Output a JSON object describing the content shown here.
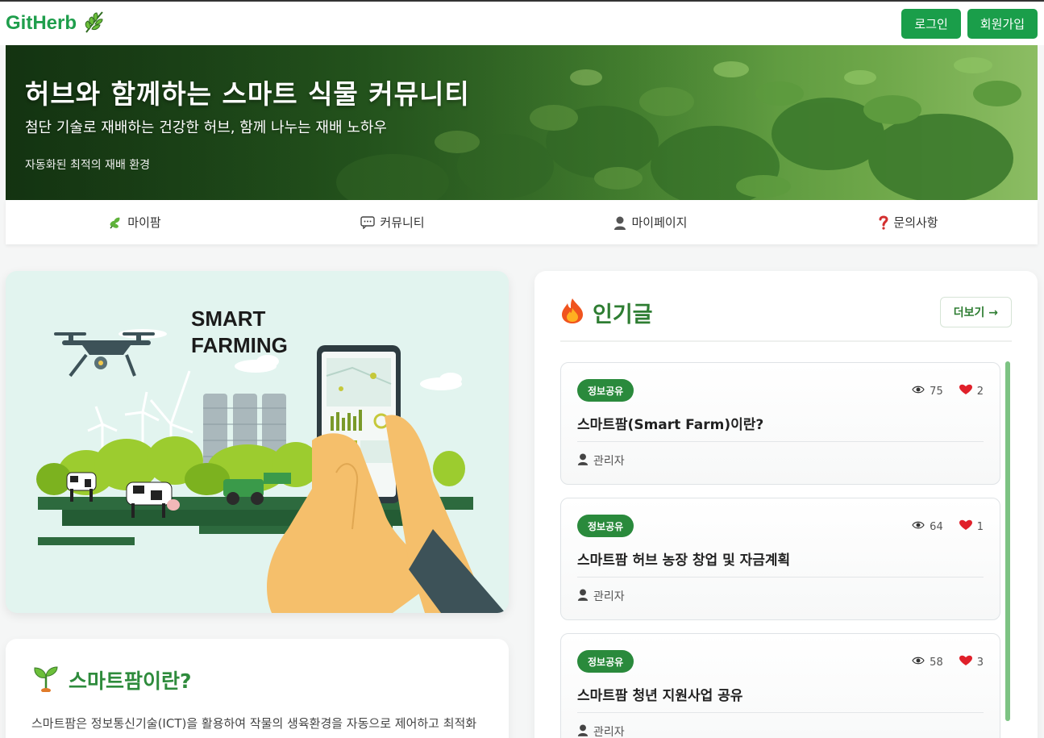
{
  "header": {
    "logo_text": "GitHerb",
    "login_label": "로그인",
    "signup_label": "회원가입"
  },
  "hero": {
    "title": "허브와 함께하는 스마트 식물 커뮤니티",
    "subtitle": "첨단 기술로 재배하는 건강한 허브, 함께 나누는 재배 노하우",
    "note": "자동화된 최적의 재배 환경"
  },
  "nav": {
    "items": [
      {
        "label": "마이팜",
        "icon": "herb-icon"
      },
      {
        "label": "커뮤니티",
        "icon": "chat-icon"
      },
      {
        "label": "마이페이지",
        "icon": "user-icon"
      },
      {
        "label": "문의사항",
        "icon": "question-icon"
      }
    ]
  },
  "illustration": {
    "line1": "SMART",
    "line2": "FARMING"
  },
  "info": {
    "title": "스마트팜이란?",
    "text": "스마트팜은 정보통신기술(ICT)을 활용하여 작물의 생육환경을 자동으로 제어하고 최적화하는 첨단 농업 시스템입니다."
  },
  "popular": {
    "title": "인기글",
    "more_label": "더보기 →",
    "posts": [
      {
        "tag": "정보공유",
        "views": "75",
        "likes": "2",
        "title": "스마트팜(Smart Farm)이란?",
        "author": "관리자"
      },
      {
        "tag": "정보공유",
        "views": "64",
        "likes": "1",
        "title": "스마트팜 허브 농장 창업 및 자금계획",
        "author": "관리자"
      },
      {
        "tag": "정보공유",
        "views": "58",
        "likes": "3",
        "title": "스마트팜 청년 지원사업 공유",
        "author": "관리자"
      }
    ]
  },
  "colors": {
    "brand": "#1f9e4c",
    "button": "#1a9e4a",
    "tag": "#2a8a3c",
    "scrollbar": "#7dc383"
  }
}
